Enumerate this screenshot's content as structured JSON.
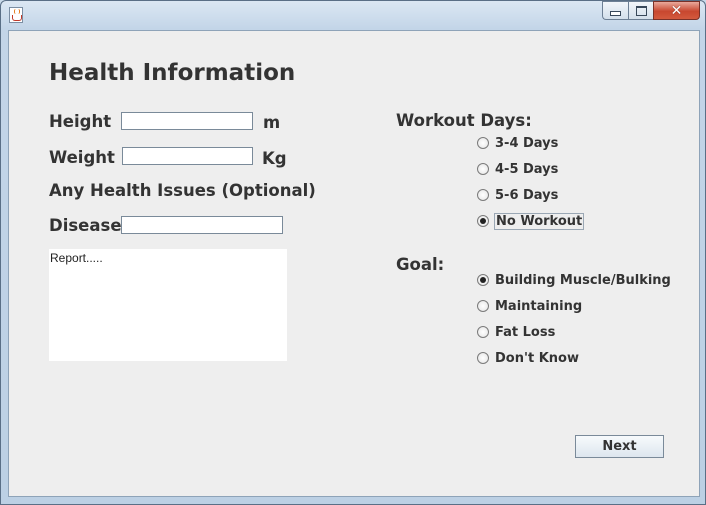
{
  "window": {
    "title": ""
  },
  "form": {
    "title": "Health Information",
    "height_label": "Height",
    "height_value": "",
    "height_unit": "m",
    "weight_label": "Weight",
    "weight_value": "",
    "weight_unit": "Kg",
    "health_issues_label": "Any Health Issues (Optional)",
    "disease_label": "Disease",
    "disease_value": "",
    "report_text": "Report....."
  },
  "workout": {
    "label": "Workout Days:",
    "options": [
      {
        "label": "3-4 Days",
        "selected": false
      },
      {
        "label": "4-5 Days",
        "selected": false
      },
      {
        "label": "5-6 Days",
        "selected": false
      },
      {
        "label": "No Workout",
        "selected": true
      }
    ]
  },
  "goal": {
    "label": "Goal:",
    "options": [
      {
        "label": "Building Muscle/Bulking",
        "selected": true
      },
      {
        "label": "Maintaining",
        "selected": false
      },
      {
        "label": "Fat Loss",
        "selected": false
      },
      {
        "label": "Don't Know",
        "selected": false
      }
    ]
  },
  "actions": {
    "next_label": "Next"
  },
  "icons": {
    "app": "java-cup-icon",
    "minimize": "minimize-icon",
    "maximize": "maximize-icon",
    "close": "close-icon"
  }
}
